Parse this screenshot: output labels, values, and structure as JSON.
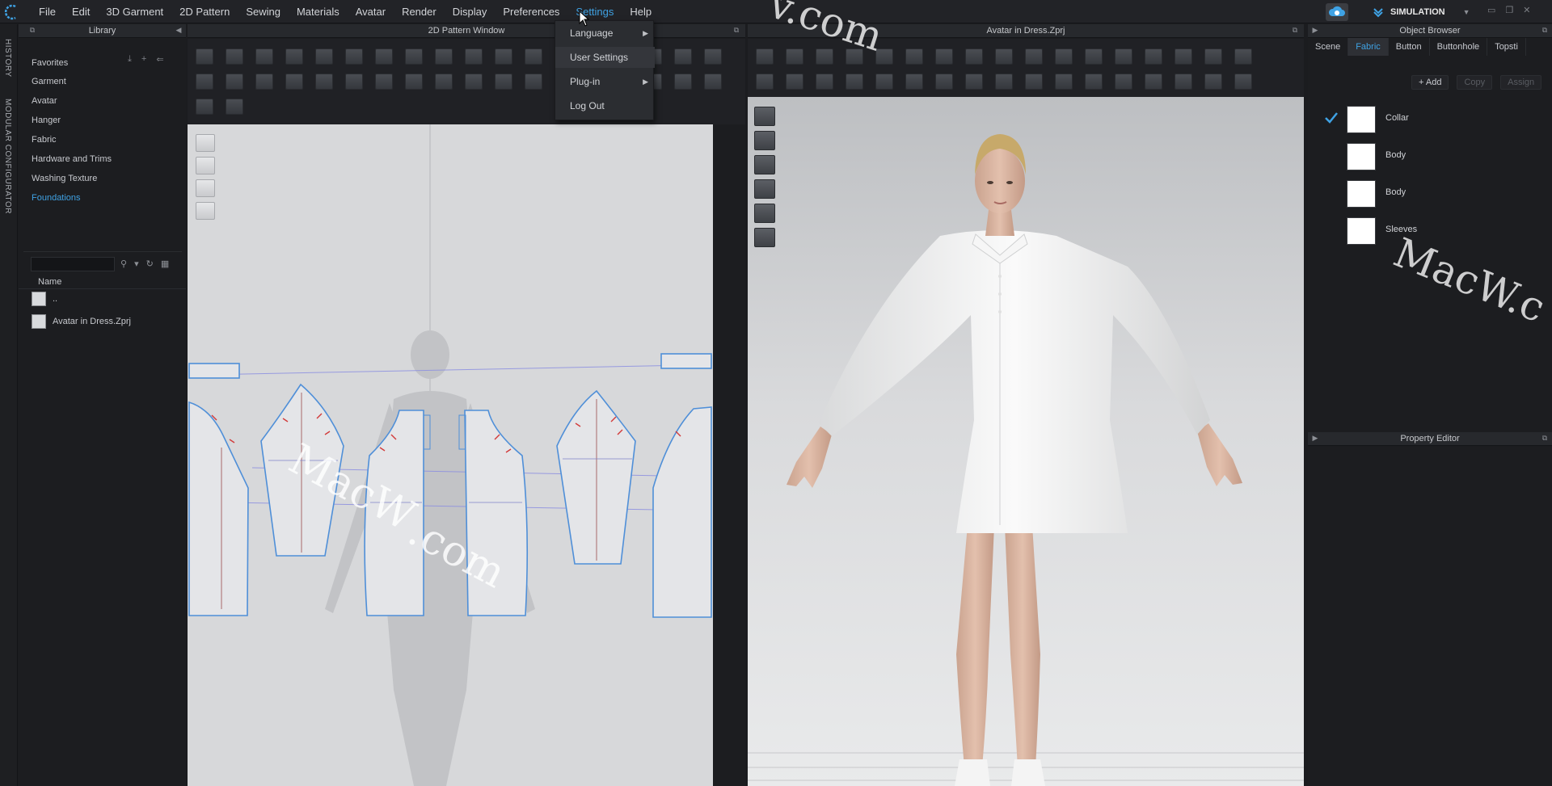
{
  "menubar": {
    "items": [
      "File",
      "Edit",
      "3D Garment",
      "2D Pattern",
      "Sewing",
      "Materials",
      "Avatar",
      "Render",
      "Display",
      "Preferences",
      "Settings",
      "Help"
    ],
    "active_index": 10,
    "mode_label": "SIMULATION"
  },
  "settings_menu": {
    "items": [
      {
        "label": "Language",
        "submenu": true
      },
      {
        "label": "User Settings",
        "submenu": false
      },
      {
        "label": "Plug-in",
        "submenu": true
      },
      {
        "label": "Log Out",
        "submenu": false
      }
    ]
  },
  "side_strip": {
    "history": "HISTORY",
    "modular": "MODULAR CONFIGURATOR"
  },
  "library": {
    "title": "Library",
    "items": [
      "Favorites",
      "Garment",
      "Avatar",
      "Hanger",
      "Fabric",
      "Hardware and Trims",
      "Washing Texture",
      "Foundations"
    ],
    "selected_index": 7,
    "search_value": "",
    "column_name": "Name",
    "files": [
      "..",
      "Avatar in Dress.Zprj"
    ]
  },
  "pattern_window": {
    "title": "2D Pattern Window"
  },
  "viewer3d": {
    "title": "Avatar in Dress.Zprj"
  },
  "object_browser": {
    "title": "Object Browser",
    "tabs": [
      "Scene",
      "Fabric",
      "Button",
      "Buttonhole",
      "Topsti"
    ],
    "active_tab": 1,
    "actions": [
      {
        "label": "+ Add",
        "enabled": true
      },
      {
        "label": "Copy",
        "enabled": false
      },
      {
        "label": "Assign",
        "enabled": false
      }
    ],
    "fabrics": [
      {
        "name": "Collar",
        "checked": true,
        "color": "#ffffff"
      },
      {
        "name": "Body",
        "checked": false,
        "color": "#ffffff"
      },
      {
        "name": "Body",
        "checked": false,
        "color": "#ffffff"
      },
      {
        "name": "Sleeves",
        "checked": false,
        "color": "#ffffff"
      }
    ]
  },
  "property_editor": {
    "title": "Property Editor"
  },
  "watermarks": {
    "top": "v.com",
    "right": "MacW.c",
    "center_a": "MacW",
    "center_b": ".com"
  },
  "colors": {
    "accent": "#3fa2e4",
    "panel_bg": "#1c1d20",
    "pattern_bg": "#d7d8da",
    "pattern_outline": "#4f8fd8",
    "notch": "#d23a3a"
  }
}
